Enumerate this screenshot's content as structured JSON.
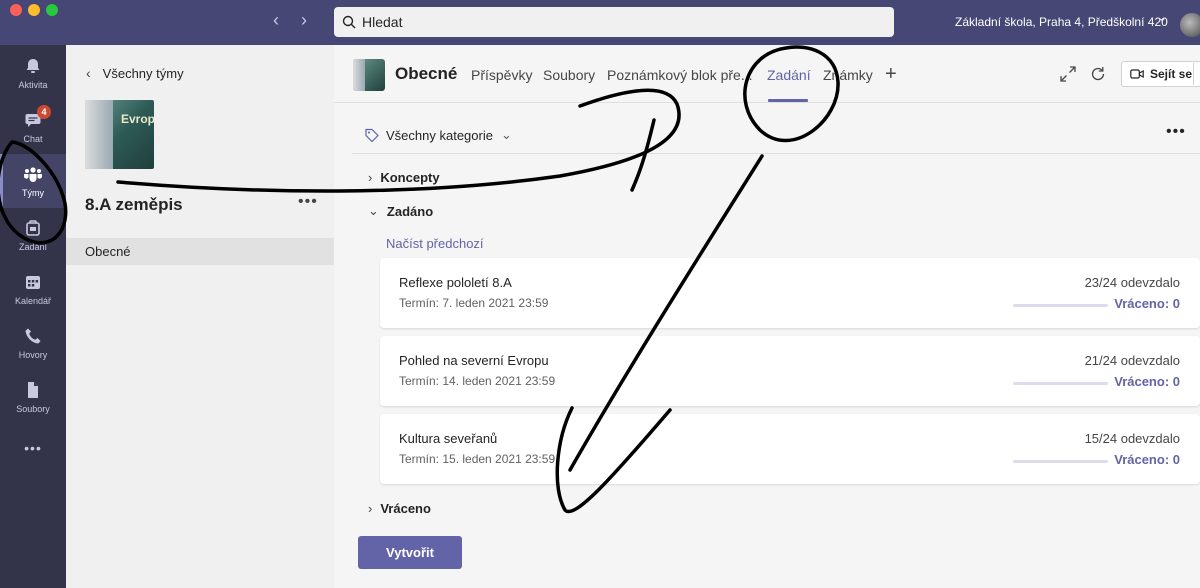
{
  "titlebar": {
    "search_placeholder": "Hledat",
    "org_name": "Základní škola, Praha 4, Předškolní 420"
  },
  "appbar": {
    "items": [
      {
        "label": "Aktivita",
        "icon": "bell-icon"
      },
      {
        "label": "Chat",
        "icon": "chat-icon",
        "badge": "4"
      },
      {
        "label": "Týmy",
        "icon": "teams-icon"
      },
      {
        "label": "Zadání",
        "icon": "assignments-icon"
      },
      {
        "label": "Kalendář",
        "icon": "calendar-icon"
      },
      {
        "label": "Hovory",
        "icon": "phone-icon"
      },
      {
        "label": "Soubory",
        "icon": "file-icon"
      }
    ],
    "more": "•••"
  },
  "team_panel": {
    "back_label": "Všechny týmy",
    "team_image_text": "Evrop",
    "team_name": "8.A zeměpis",
    "more": "•••",
    "channels": [
      "Obecné"
    ]
  },
  "main": {
    "channel_title": "Obecné",
    "tabs": [
      "Příspěvky",
      "Soubory",
      "Poznámkový blok pře...",
      "Zadání",
      "Známky"
    ],
    "active_tab": "Zadání",
    "meet_label": "Sejít se",
    "filter_label": "Všechny kategorie",
    "more": "•••",
    "sections": {
      "drafts": "Koncepty",
      "assigned": "Zadáno",
      "returned": "Vráceno"
    },
    "load_previous": "Načíst předchozí",
    "assignments": [
      {
        "title": "Reflexe pololetí 8.A",
        "due": "Termín: 7. leden 2021 23:59",
        "submitted": "23/24 odevzdalo",
        "returned": "Vráceno: 0"
      },
      {
        "title": "Pohled na severní Evropu",
        "due": "Termín: 14. leden 2021 23:59",
        "submitted": "21/24 odevzdalo",
        "returned": "Vráceno: 0"
      },
      {
        "title": "Kultura seveřanů",
        "due": "Termín: 15. leden 2021 23:59",
        "submitted": "15/24 odevzdalo",
        "returned": "Vráceno: 0"
      }
    ],
    "create_label": "Vytvořit"
  },
  "colors": {
    "titlebar": "#464775",
    "appbar": "#33344a",
    "accent": "#6264a7",
    "badge": "#cc4a31"
  }
}
